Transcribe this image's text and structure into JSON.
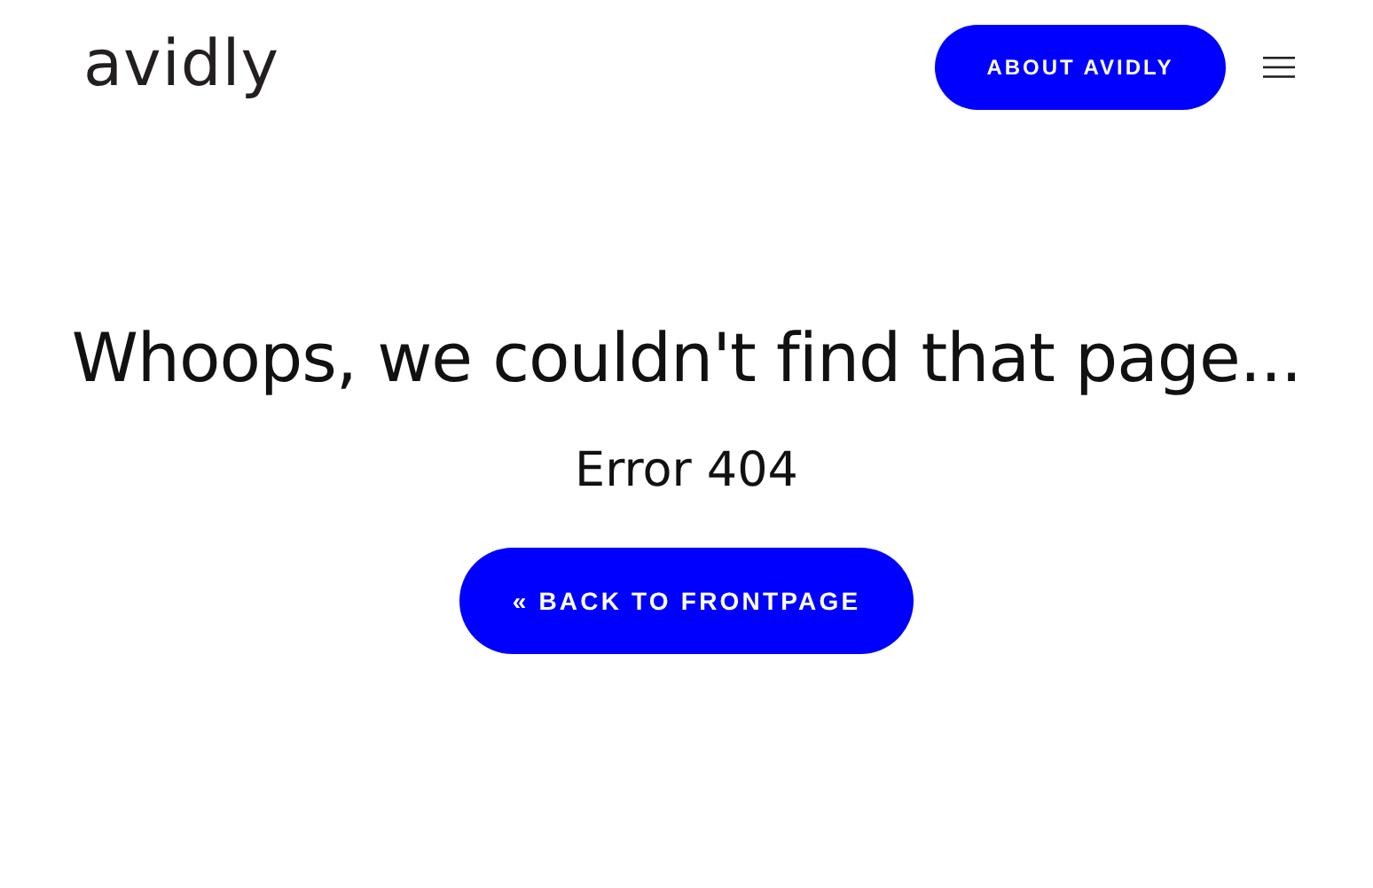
{
  "header": {
    "logo": "avidly",
    "about_button": "ABOUT AVIDLY"
  },
  "main": {
    "heading": "Whoops, we couldn't find that page...",
    "error": "Error 404",
    "back_button": "« BACK TO FRONTPAGE"
  }
}
